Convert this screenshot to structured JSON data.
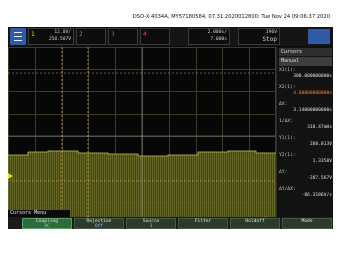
{
  "header": {
    "title": "DSO-X 4034A, MY57180584, 07.31.2020012800: Tue Nov 24 09:06:37 2020"
  },
  "topbar": {
    "channels": [
      {
        "num": "1",
        "scale": "12.0V/",
        "offset": "258.587V",
        "color": "#e6e600"
      },
      {
        "num": "2",
        "scale": "",
        "offset": "",
        "color": "#29cc29"
      },
      {
        "num": "3",
        "scale": "",
        "offset": "",
        "color": "#3f6cff"
      },
      {
        "num": "4",
        "scale": "",
        "offset": "",
        "color": "#ff3f55"
      }
    ],
    "timebase": {
      "scale": "2.000s/",
      "delay": "7.000s"
    },
    "trigger": {
      "mode": "Stop",
      "value": "196V"
    }
  },
  "panel": {
    "title": "Cursors",
    "mode": "Manual",
    "rows": [
      {
        "key": "X1(1):",
        "value": "300.000000000s"
      },
      {
        "key": "X2(1):",
        "value": "4.00000000000s"
      },
      {
        "key": "ΔX:",
        "value": "3.14000000000s"
      },
      {
        "key": "1/ΔX:",
        "value": "318.47mHz"
      },
      {
        "key": "Y1(1):",
        "value": "288.813V"
      },
      {
        "key": "Y2(1):",
        "value": "1.3350V"
      },
      {
        "key": "ΔY:",
        "value": "-287.567V"
      },
      {
        "key": "ΔY/ΔX:",
        "value": "-86.3186V/s"
      }
    ]
  },
  "softkeys": {
    "title": "Cursors Menu",
    "keys": [
      {
        "label": "Coupling",
        "value": "AC"
      },
      {
        "label": "Rejection",
        "value": "Off"
      },
      {
        "label": "Source",
        "value": "1"
      },
      {
        "label": "Filter",
        "value": ""
      },
      {
        "label": "Holdoff",
        "value": ""
      },
      {
        "label": "Mode",
        "value": ""
      }
    ]
  }
}
